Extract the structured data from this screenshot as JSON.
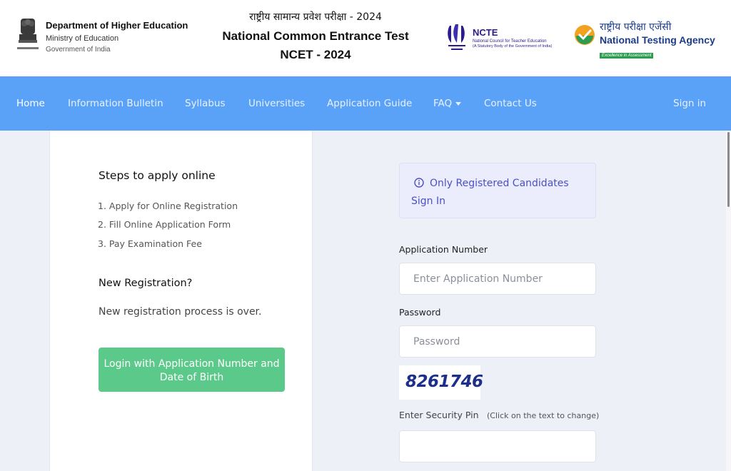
{
  "header": {
    "dept_title": "Department of Higher Education",
    "ministry": "Ministry of Education",
    "government": "Government of India",
    "hindi_title": "राष्ट्रीय सामान्य प्रवेश परीक्षा  -  2024",
    "english_title": "National Common Entrance Test",
    "short_title": "NCET - 2024",
    "ncte": {
      "name": "NCTE",
      "full": "National Council for Teacher Education",
      "sub": "(A Statutory Body of the Government of India)"
    },
    "nta": {
      "hindi": "राष्ट्रीय  परीक्षा  एजेंसी",
      "english": "National Testing Agency",
      "tagline": "Excellence in Assessment"
    }
  },
  "nav": {
    "items": [
      {
        "label": "Home"
      },
      {
        "label": "Information Bulletin"
      },
      {
        "label": "Syllabus"
      },
      {
        "label": "Universities"
      },
      {
        "label": "Application Guide"
      },
      {
        "label": "FAQ"
      },
      {
        "label": "Contact Us"
      }
    ],
    "signin": "Sign in"
  },
  "left": {
    "steps_title": "Steps to apply online",
    "steps": [
      "1.  Apply for Online Registration",
      "2.  Fill Online Application Form",
      "3.  Pay Examination Fee"
    ],
    "new_reg_title": "New Registration?",
    "new_reg_text": "New registration process is over.",
    "login_button": "Login with Application Number and Date of Birth"
  },
  "right": {
    "alert": "Only Registered Candidates Sign In",
    "app_number_label": "Application Number",
    "app_number_placeholder": "Enter Application Number",
    "password_label": "Password",
    "password_placeholder": "Password",
    "captcha": "8261746",
    "security_pin_label": "Enter Security Pin",
    "security_pin_hint": "(Click on the text to change)"
  },
  "colors": {
    "navbar": "#5aa2f7",
    "login_button": "#5bc98a",
    "alert_text": "#4b4fc9"
  }
}
